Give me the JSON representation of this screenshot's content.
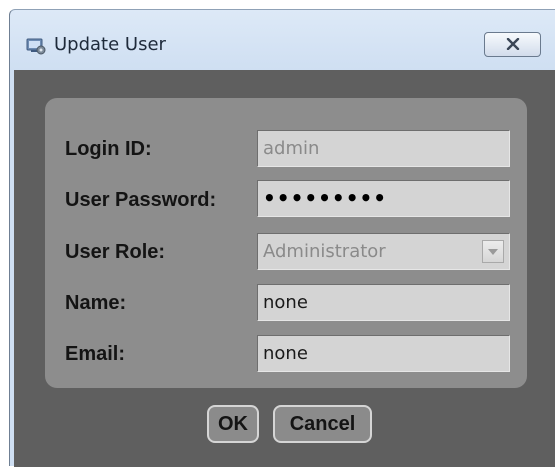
{
  "window": {
    "title": "Update User",
    "close_icon": "close-x-icon",
    "app_icon": "user-settings-icon"
  },
  "form": {
    "login_id": {
      "label": "Login ID:",
      "value": "admin",
      "enabled": false
    },
    "password": {
      "label": "User Password:",
      "value": "•••••••••",
      "enabled": true
    },
    "role": {
      "label": "User Role:",
      "value": "Administrator",
      "enabled": false
    },
    "name": {
      "label": "Name:",
      "value": "none",
      "enabled": true
    },
    "email": {
      "label": "Email:",
      "value": "none",
      "enabled": true
    }
  },
  "buttons": {
    "ok": "OK",
    "cancel": "Cancel"
  },
  "colors": {
    "client_bg": "#5f5f5f",
    "panel_bg": "#8d8d8d",
    "field_bg": "#d4d4d4"
  }
}
